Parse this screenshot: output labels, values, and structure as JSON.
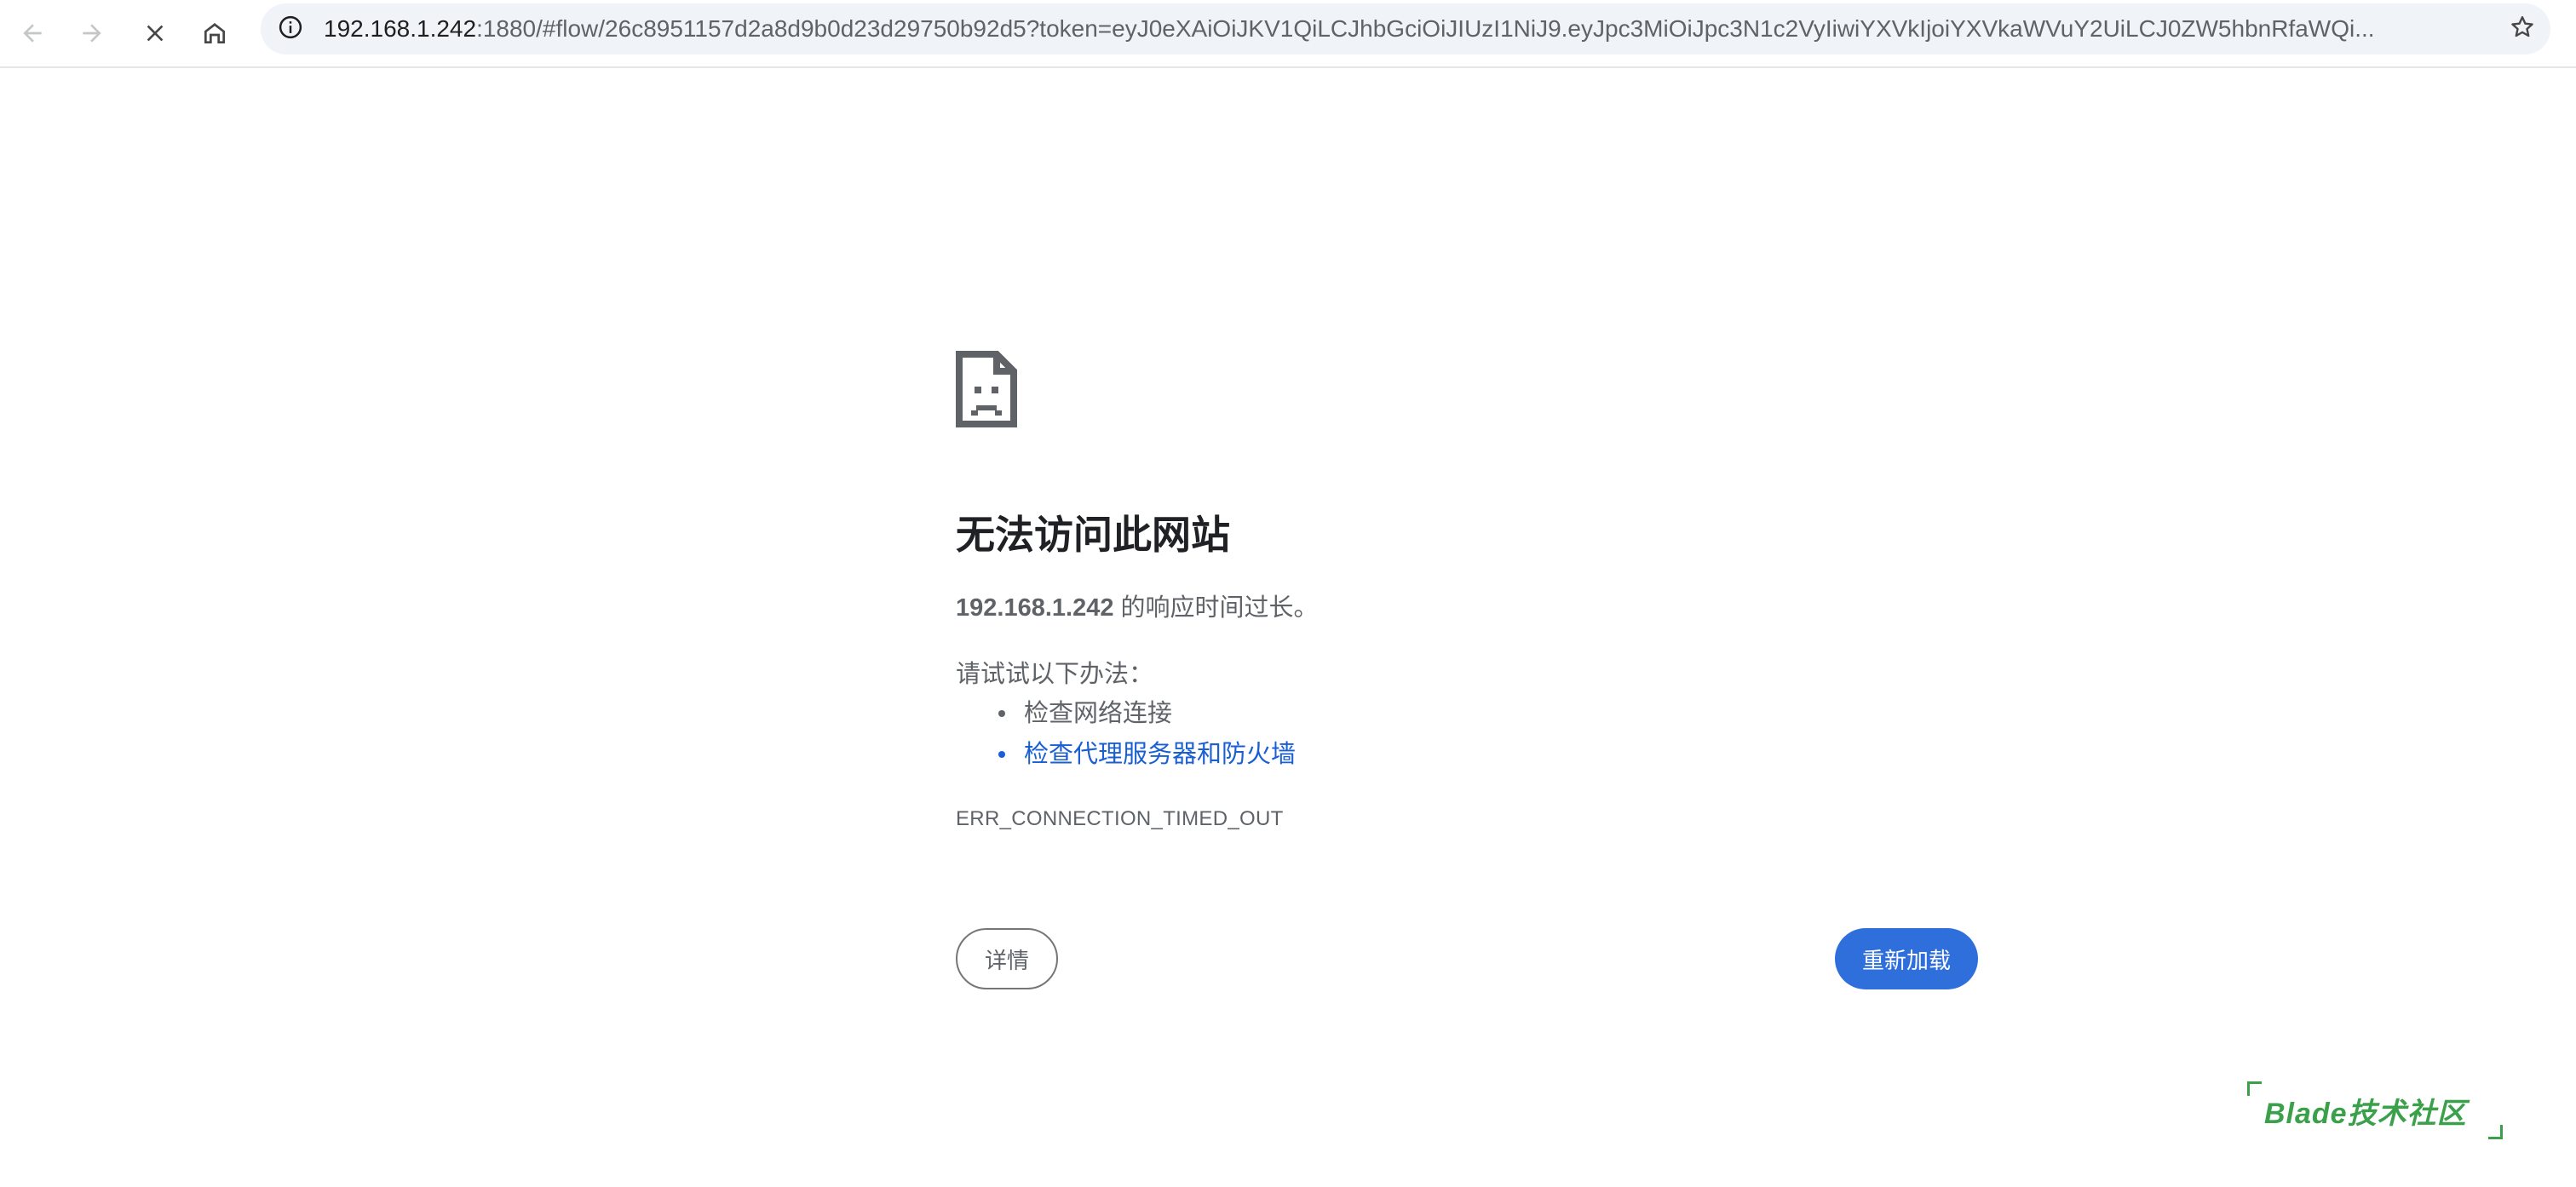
{
  "browser": {
    "url_host": "192.168.1.242",
    "url_rest": ":1880/#flow/26c8951157d2a8d9b0d23d29750b92d5?token=eyJ0eXAiOiJKV1QiLCJhbGciOiJIUzI1NiJ9.eyJpc3MiOiJpc3N1c2VyIiwiYXVkIjoiYXVkaWVuY2UiLCJ0ZW5hbnRfaWQi...",
    "icons": {
      "back": "arrow-left-icon",
      "forward": "arrow-right-icon",
      "stop": "close-icon",
      "home": "home-icon",
      "site_info": "info-icon",
      "bookmark": "star-icon"
    }
  },
  "error": {
    "icon": "sad-document-icon",
    "title": "无法访问此网站",
    "summary_host": "192.168.1.242",
    "summary_text": " 的响应时间过长。",
    "try_label": "请试试以下办法：",
    "suggestions": [
      "检查网络连接",
      "检查代理服务器和防火墙"
    ],
    "code": "ERR_CONNECTION_TIMED_OUT",
    "details_label": "详情",
    "reload_label": "重新加载"
  },
  "watermark": {
    "text": "Blade技术社区"
  },
  "colors": {
    "link": "#1a5fd1",
    "primary_button": "#2f6fdc",
    "watermark": "#3aa04a",
    "text_secondary": "#5f6368"
  }
}
